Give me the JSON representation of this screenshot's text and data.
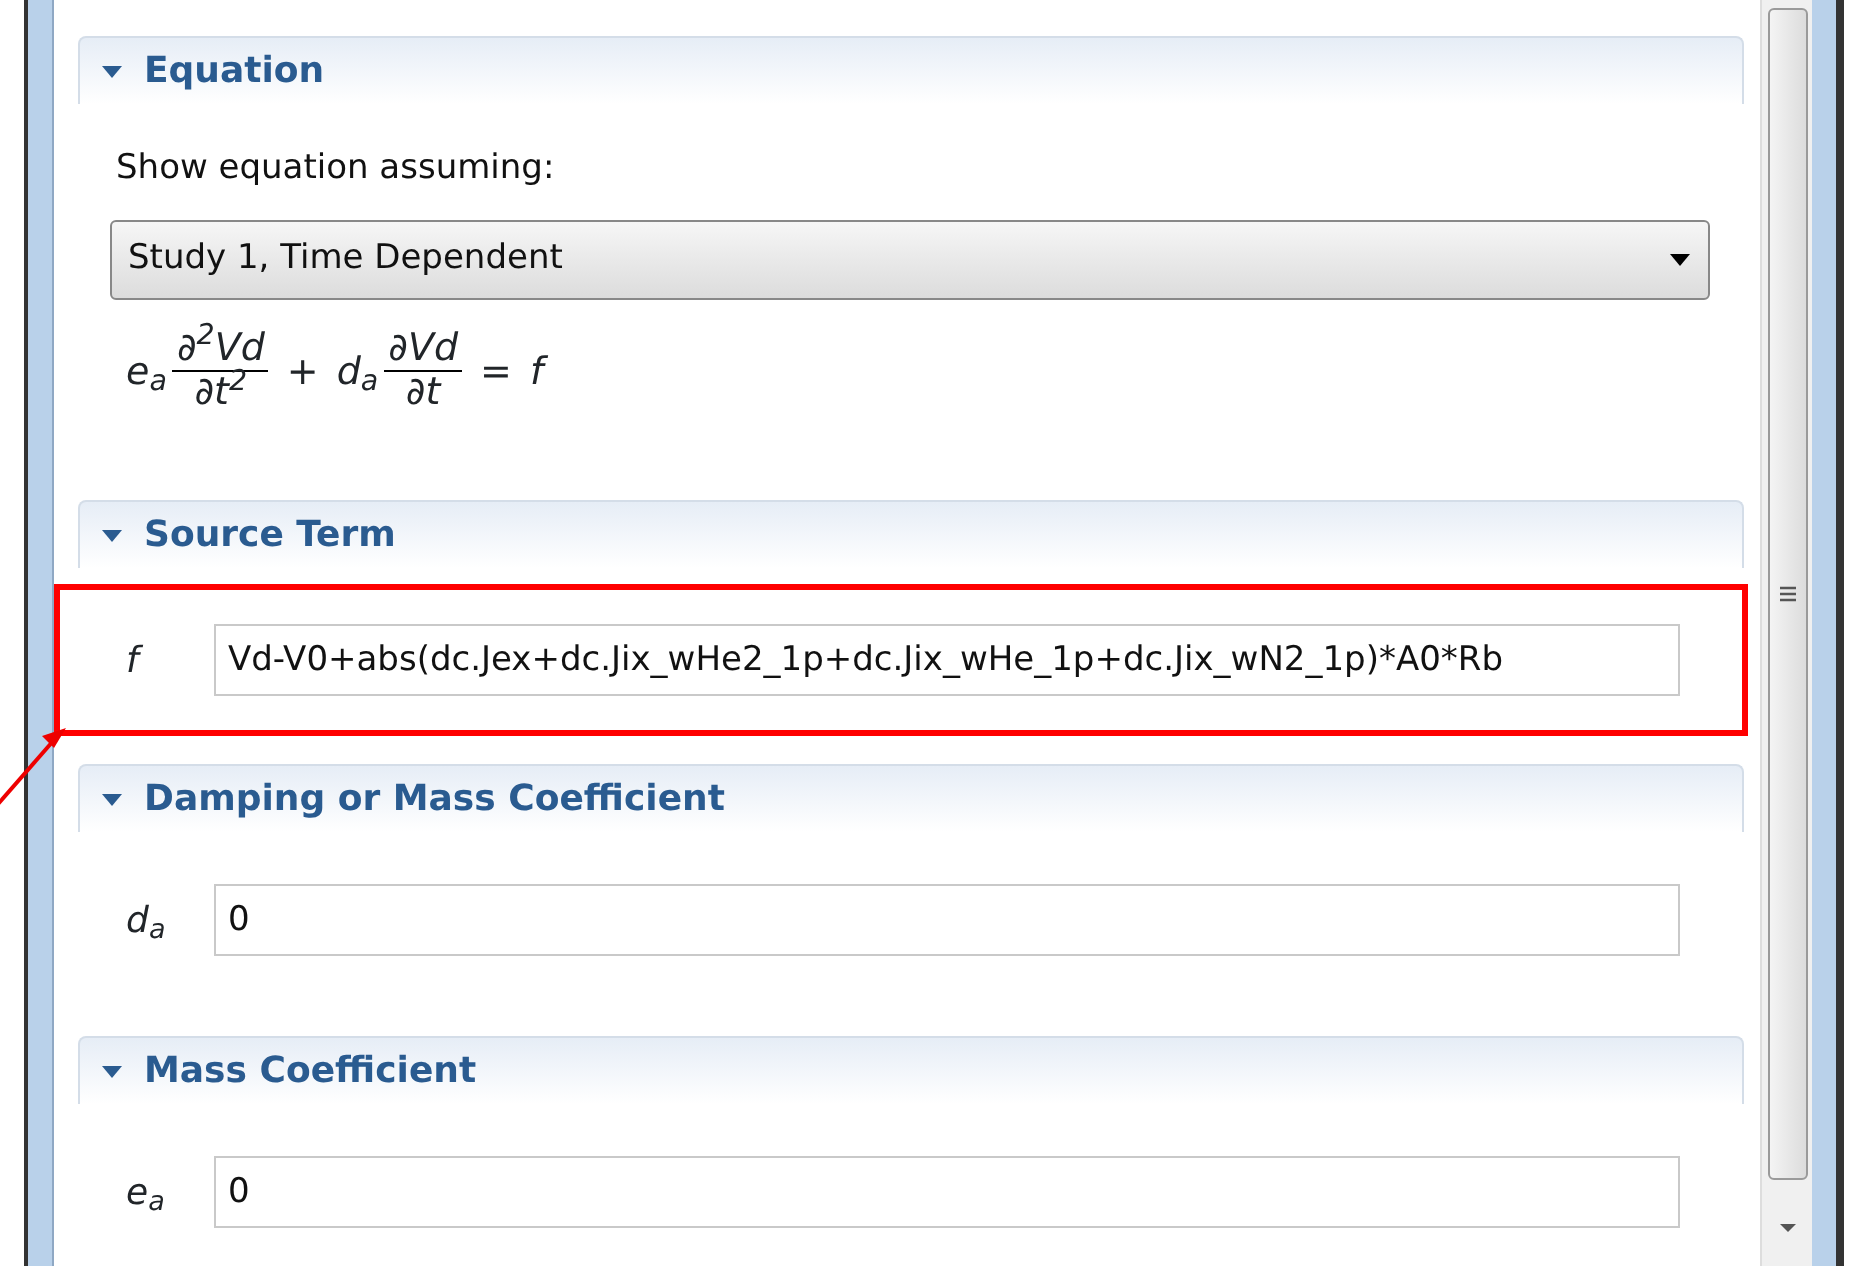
{
  "sections": [
    {
      "title": "Equation",
      "expanded": true,
      "kind": "equation",
      "prompt": "Show equation assuming:",
      "select_value": "Study 1, Time Dependent",
      "equation": [
        {
          "kind": "text",
          "text": "e$_{a}$"
        },
        {
          "kind": "frac",
          "numerator": "∂$^{2}$Vd",
          "denominator": "∂t$^{2}$"
        },
        {
          "kind": "op",
          "text": "+"
        },
        {
          "kind": "text",
          "text": "d$_{a}$"
        },
        {
          "kind": "frac",
          "numerator": "∂Vd",
          "denominator": "∂t"
        },
        {
          "kind": "op",
          "text": "="
        },
        {
          "kind": "text",
          "text": "f"
        }
      ]
    },
    {
      "title": "Source Term",
      "expanded": true,
      "kind": "field",
      "label": "f",
      "value": "Vd-V0+abs(dc.Jex+dc.Jix_wHe2_1p+dc.Jix_wHe_1p+dc.Jix_wN2_1p)*A0*Rb",
      "highlighted": true
    },
    {
      "title": "Damping or Mass Coefficient",
      "expanded": true,
      "kind": "field",
      "label": "d$_{a}$",
      "value": "0",
      "highlighted": false
    },
    {
      "title": "Mass Coefficient",
      "expanded": true,
      "kind": "field",
      "label": "e$_{a}$",
      "value": "0",
      "highlighted": false
    }
  ]
}
